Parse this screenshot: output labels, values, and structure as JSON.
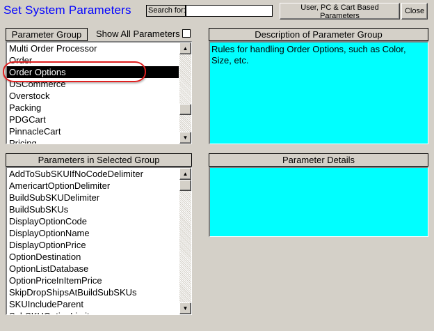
{
  "window": {
    "title": "Set System Parameters"
  },
  "search": {
    "label": "Search for:",
    "value": ""
  },
  "buttons": {
    "user_pc_cart": "User, PC & Cart Based Parameters",
    "close": "Close"
  },
  "parameter_group": {
    "header": "Parameter Group",
    "show_all_label": "Show All Parameters",
    "show_all_checked": false,
    "items": [
      "Multi Order Processor",
      "Order",
      "Order Options",
      "USCommerce",
      "Overstock",
      "Packing",
      "PDGCart",
      "PinnacleCart",
      "Pricing"
    ],
    "selected": "Order Options"
  },
  "description": {
    "header": "Description of Parameter Group",
    "text": "Rules for handling Order Options, such as Color, Size, etc."
  },
  "parameters": {
    "header": "Parameters in Selected Group",
    "items": [
      "AddToSubSKUIfNoCodeDelimiter",
      "AmericartOptionDelimiter",
      "BuildSubSKUDelimiter",
      "BuildSubSKUs",
      "DisplayOptionCode",
      "DisplayOptionName",
      "DisplayOptionPrice",
      "OptionDestination",
      "OptionListDatabase",
      "OptionPriceInItemPrice",
      "SkipDropShipsAtBuildSubSKUs",
      "SKUIncludeParent",
      "SubSKUOptionLimit"
    ]
  },
  "details": {
    "header": "Parameter Details",
    "text": ""
  },
  "colors": {
    "title": "#0000ff",
    "panel": "#00ffff",
    "selection": "#000000",
    "highlight_ring": "#e02020"
  }
}
